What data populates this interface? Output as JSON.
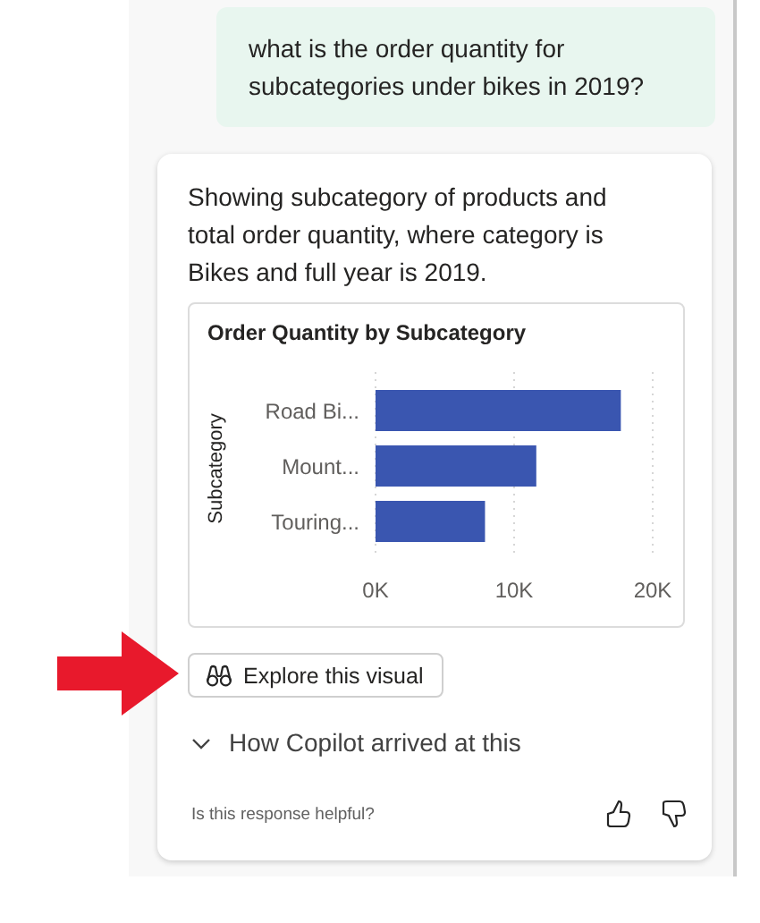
{
  "user_message": {
    "text": "what is the order quantity for subcategories under bikes in 2019?"
  },
  "response": {
    "text": "Showing subcategory of products and total order quantity, where category is Bikes and full year is 2019.",
    "chart_data": {
      "type": "bar",
      "orientation": "horizontal",
      "title": "Order Quantity by Subcategory",
      "ylabel": "Subcategory",
      "categories": [
        "Road Bi...",
        "Mount...",
        "Touring..."
      ],
      "series": [
        {
          "color": "#3a56b0",
          "values": [
            17700,
            11600,
            7900
          ]
        }
      ],
      "xlim": [
        0,
        20000
      ],
      "xticks": [
        {
          "value": 0,
          "label": "0K"
        },
        {
          "value": 10000,
          "label": "10K"
        },
        {
          "value": 20000,
          "label": "20K"
        }
      ]
    },
    "explore_button": {
      "label": "Explore this visual"
    },
    "reasoning": {
      "label": "How Copilot arrived at this",
      "expanded": false
    },
    "feedback": {
      "prompt": "Is this response helpful?"
    }
  }
}
